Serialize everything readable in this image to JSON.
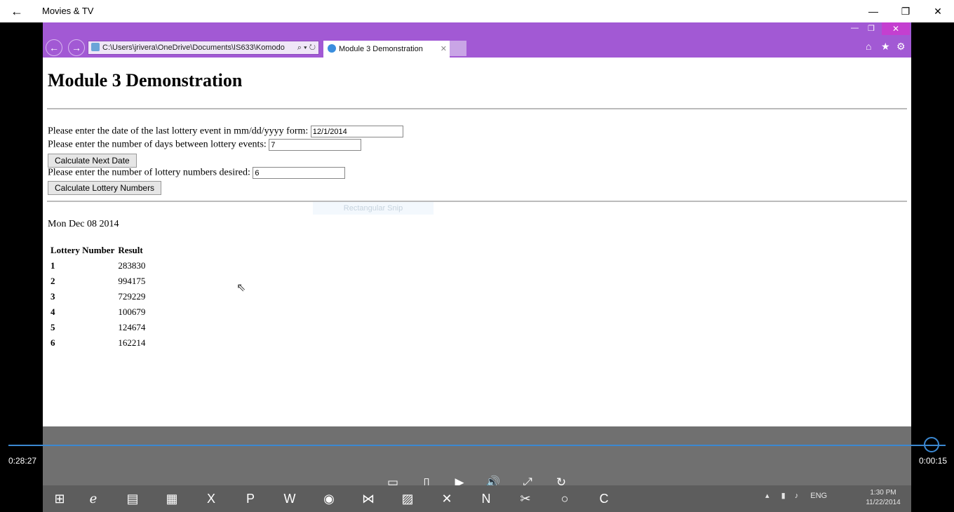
{
  "app": {
    "title": "Movies & TV",
    "back_icon": "←",
    "minimize": "—",
    "maximize": "❐",
    "close": "✕"
  },
  "browser": {
    "address": "C:\\Users\\jrivera\\OneDrive\\Documents\\IS633\\Komodo",
    "address_tools": "⌕ ▾ ↻",
    "tab_title": "Module 3 Demonstration",
    "tab_close": "✕",
    "back": "←",
    "forward": "→",
    "home": "⌂",
    "favorites": "★",
    "settings": "⚙",
    "ctrl_min": "—",
    "ctrl_restore": "❐",
    "ctrl_close": "✕"
  },
  "page": {
    "heading": "Module 3 Demonstration",
    "date_label": "Please enter the date of the last lottery event in mm/dd/yyyy form:",
    "date_value": "12/1/2014",
    "days_label": "Please enter the number of days between lottery events:",
    "days_value": "7",
    "calc_date_button": "Calculate Next Date",
    "numbers_label": "Please enter the number of lottery numbers desired:",
    "numbers_value": "6",
    "calc_numbers_button": "Calculate Lottery Numbers",
    "snip_ghost": "Rectangular Snip",
    "next_date": "Mon Dec 08 2014",
    "table": {
      "headers": [
        "Lottery Number",
        "Result"
      ],
      "rows": [
        [
          "1",
          "283830"
        ],
        [
          "2",
          "994175"
        ],
        [
          "3",
          "729229"
        ],
        [
          "4",
          "100679"
        ],
        [
          "5",
          "124674"
        ],
        [
          "6",
          "162214"
        ]
      ]
    }
  },
  "player": {
    "elapsed": "0:28:27",
    "remaining": "0:00:15",
    "progress": 0.985,
    "cast_icon": "▭",
    "aspect_icon": "▯",
    "play_icon": "▶",
    "volume_icon": "🔊",
    "fullscreen_icon": "⤢",
    "repeat_icon": "↻"
  },
  "taskbar": {
    "tray_lang": "ENG",
    "clock_time": "1:30 PM",
    "clock_date": "11/22/2014"
  }
}
